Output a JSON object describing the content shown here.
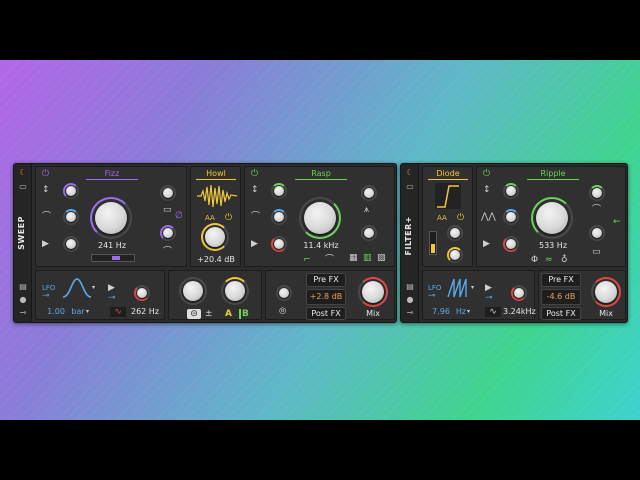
{
  "colors": {
    "purple": "#9c6ef0",
    "yellow": "#f0c83c",
    "green": "#6bd35a",
    "orange": "#e9a25c",
    "blue": "#5aa8e8",
    "red": "#e04848"
  },
  "sweep": {
    "device_name": "SWEEP",
    "fizz": {
      "title": "Fizz",
      "freq": "241 Hz"
    },
    "howl": {
      "title": "Howl",
      "aa": "AA",
      "gain": "+20.4 dB"
    },
    "rasp": {
      "title": "Rasp",
      "freq": "11.4 kHz"
    },
    "lfo": {
      "label": "LFO",
      "rate": "1.00",
      "unit": "bar",
      "freq": "262 Hz"
    },
    "ab": {
      "a": "A",
      "b": "B"
    },
    "fx": {
      "pre": "Pre FX",
      "amount": "+2.8 dB",
      "post": "Post FX",
      "mix": "Mix"
    }
  },
  "filter": {
    "device_name": "FILTER+",
    "diode": {
      "title": "Diode",
      "aa": "AA"
    },
    "ripple": {
      "title": "Ripple",
      "freq": "533 Hz"
    },
    "lfo": {
      "label": "LFO",
      "rate": "7.96",
      "unit": "Hz",
      "freq": "3.24kHz"
    },
    "fx": {
      "pre": "Pre FX",
      "amount": "-4.6 dB",
      "post": "Post FX",
      "mix": "Mix"
    }
  }
}
